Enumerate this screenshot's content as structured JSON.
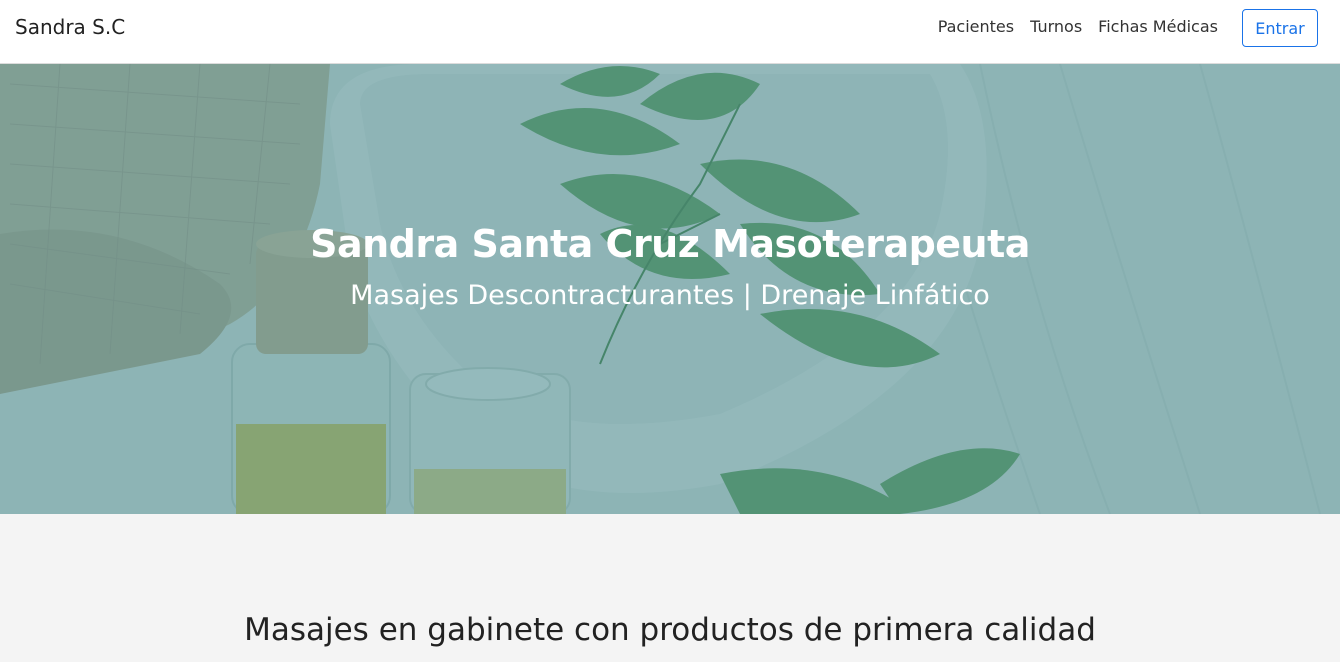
{
  "navbar": {
    "brand": "Sandra S.C",
    "links": [
      "Pacientes",
      "Turnos",
      "Fichas Médicas"
    ],
    "login_button": "Entrar"
  },
  "hero": {
    "title": "Sandra Santa Cruz Masoterapeuta",
    "subtitle": "Masajes Descontracturantes | Drenaje Linfático",
    "overlay_color": "#4b8c91"
  },
  "section": {
    "heading": "Masajes en gabinete con productos de primera calidad"
  }
}
